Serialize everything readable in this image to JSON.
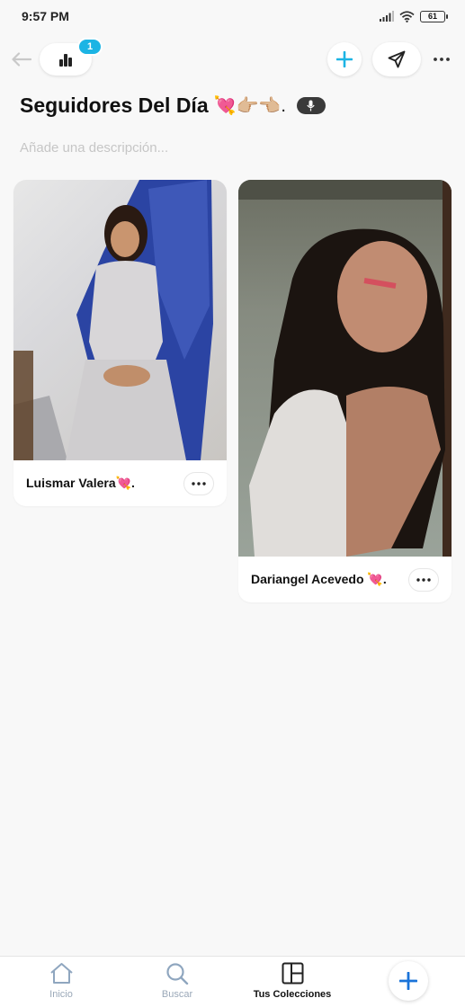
{
  "status_bar": {
    "time": "9:57 PM",
    "battery": "61"
  },
  "top_bar": {
    "badge_count": "1"
  },
  "collection": {
    "title": "Seguidores Del Día",
    "title_emojis": "💘👉🏼👈🏼.",
    "description_placeholder": "Añade una descripción..."
  },
  "cards": [
    {
      "name": "Luismar Valera💘."
    },
    {
      "name": "Dariangel Acevedo 💘."
    }
  ],
  "bottom_nav": {
    "home": "Inicio",
    "search": "Buscar",
    "collections": "Tus Colecciones"
  },
  "colors": {
    "accent": "#1cb4e4",
    "background": "#f8f8f8",
    "nav_inactive": "#9aa8b8"
  }
}
